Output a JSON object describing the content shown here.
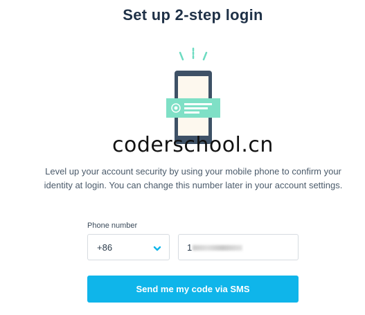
{
  "title": "Set up 2-step login",
  "watermark": "coderschool.cn",
  "description": "Level up your account security by using your mobile phone to confirm your identity at login. You can change this number later in your account settings.",
  "form": {
    "phone_label": "Phone number",
    "country_code": "+86",
    "phone_value": "1",
    "submit_label": "Send me my code via SMS"
  },
  "icons": {
    "illustration": "phone-notification-illustration",
    "dropdown": "chevron-down-icon"
  },
  "colors": {
    "title": "#1f3147",
    "accent": "#0fb5ea",
    "phone_body": "#3e5166",
    "notification": "#7fe0c6"
  }
}
